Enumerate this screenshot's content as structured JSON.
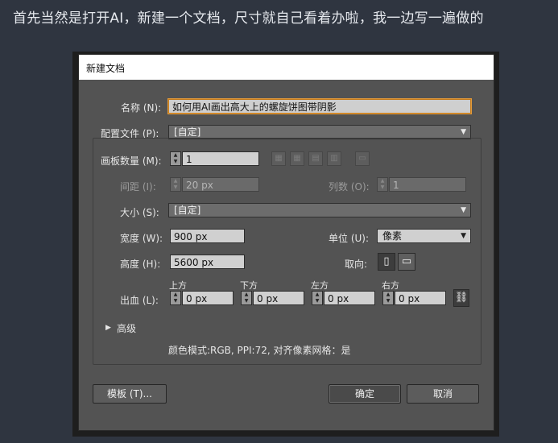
{
  "intro_text": "首先当然是打开AI，新建一个文档，尺寸就自己看着办啦，我一边写一遍做的",
  "dialog": {
    "title": "新建文档",
    "name_label": "名称 (N):",
    "name_value": "如何用AI画出高大上的螺旋饼图带阴影",
    "profile_label": "配置文件 (P):",
    "profile_value": "[自定]",
    "artboards_label": "画板数量 (M):",
    "artboards_value": "1",
    "spacing_label": "间距 (I):",
    "spacing_value": "20 px",
    "columns_label": "列数 (O):",
    "columns_value": "1",
    "size_label": "大小 (S):",
    "size_value": "[自定]",
    "width_label": "宽度 (W):",
    "width_value": "900 px",
    "units_label": "单位 (U):",
    "units_value": "像素",
    "height_label": "高度 (H):",
    "height_value": "5600 px",
    "orientation_label": "取向:",
    "bleed_label": "出血 (L):",
    "bleed_top_label": "上方",
    "bleed_bottom_label": "下方",
    "bleed_left_label": "左方",
    "bleed_right_label": "右方",
    "bleed_top_value": "0 px",
    "bleed_bottom_value": "0 px",
    "bleed_left_value": "0 px",
    "bleed_right_value": "0 px",
    "advanced_label": "高级",
    "info_text": "颜色模式:RGB, PPI:72, 对齐像素网格：是",
    "template_button": "模板 (T)...",
    "ok_button": "确定",
    "cancel_button": "取消"
  },
  "colors": {
    "page_bg": "#2f3540",
    "dialog_bg": "#535353",
    "focus_border": "#e39b3a"
  },
  "icons": {
    "dropdown": "chevron-down-icon",
    "portrait": "portrait-orientation-icon",
    "landscape": "landscape-orientation-icon",
    "link": "link-icon",
    "arrange": "artboard-arrange-icon",
    "disclosure": "disclosure-triangle-icon"
  }
}
